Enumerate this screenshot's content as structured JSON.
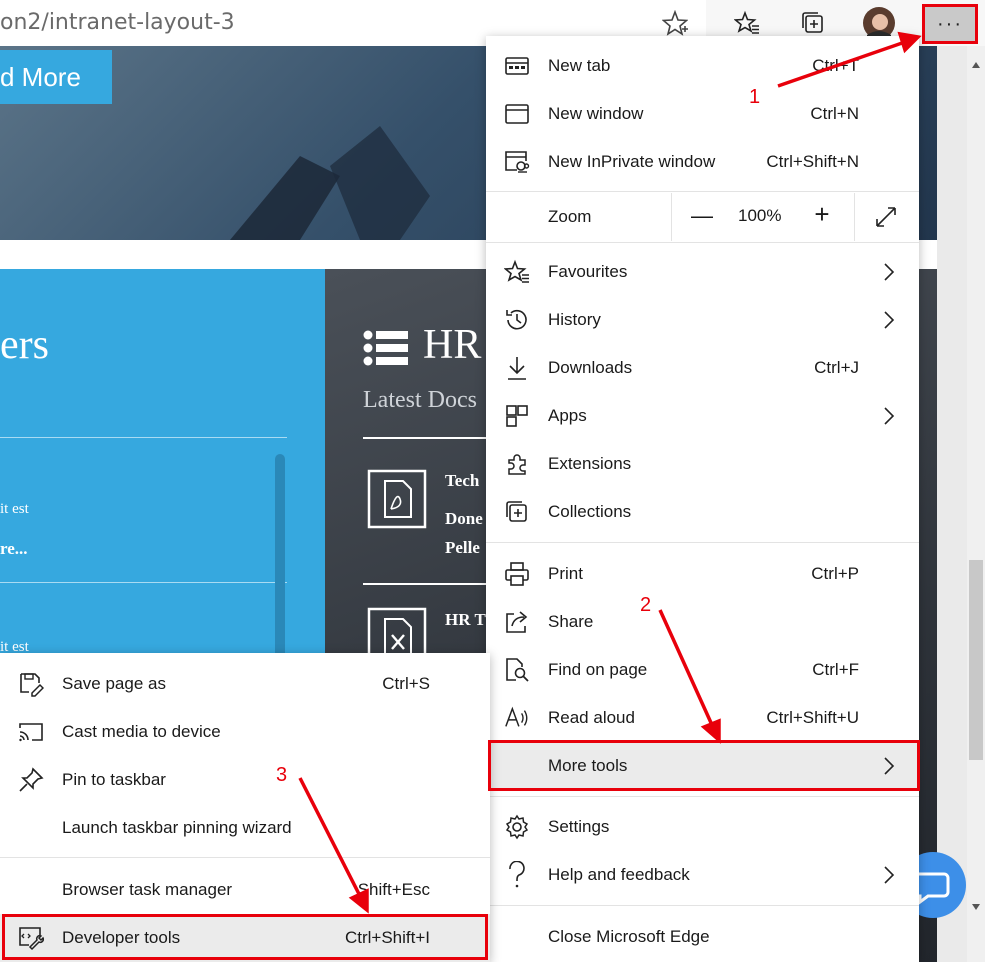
{
  "browser": {
    "url": "on2/intranet-layout-3",
    "more_button": "···"
  },
  "page": {
    "read_more": "d More",
    "left_heading": "ers",
    "left_text_1": "it est",
    "left_link_1": "re...",
    "left_text_2": "it est",
    "hr_heading": "HR",
    "latest_docs": "Latest Docs",
    "doc1_title": "Tech",
    "doc1_line1": "Done",
    "doc1_line2": "Pelle",
    "doc2_title": "HR T"
  },
  "main_menu": {
    "new_tab": {
      "label": "New tab",
      "shortcut": "Ctrl+T"
    },
    "new_window": {
      "label": "New window",
      "shortcut": "Ctrl+N"
    },
    "new_inprivate": {
      "label": "New InPrivate window",
      "shortcut": "Ctrl+Shift+N"
    },
    "zoom": {
      "label": "Zoom",
      "minus": "—",
      "value": "100%",
      "plus": "+"
    },
    "favourites": {
      "label": "Favourites"
    },
    "history": {
      "label": "History"
    },
    "downloads": {
      "label": "Downloads",
      "shortcut": "Ctrl+J"
    },
    "apps": {
      "label": "Apps"
    },
    "extensions": {
      "label": "Extensions"
    },
    "collections": {
      "label": "Collections"
    },
    "print": {
      "label": "Print",
      "shortcut": "Ctrl+P"
    },
    "share": {
      "label": "Share"
    },
    "find": {
      "label": "Find on page",
      "shortcut": "Ctrl+F"
    },
    "read_aloud": {
      "label": "Read aloud",
      "shortcut": "Ctrl+Shift+U"
    },
    "more_tools": {
      "label": "More tools"
    },
    "settings": {
      "label": "Settings"
    },
    "help": {
      "label": "Help and feedback"
    },
    "close": {
      "label": "Close Microsoft Edge"
    }
  },
  "sub_menu": {
    "save_page": {
      "label": "Save page as",
      "shortcut": "Ctrl+S"
    },
    "cast": {
      "label": "Cast media to device"
    },
    "pin": {
      "label": "Pin to taskbar"
    },
    "pin_wizard": {
      "label": "Launch taskbar pinning wizard"
    },
    "task_manager": {
      "label": "Browser task manager",
      "shortcut": "Shift+Esc"
    },
    "dev_tools": {
      "label": "Developer tools",
      "shortcut": "Ctrl+Shift+I"
    }
  },
  "annotations": {
    "step1": "1",
    "step2": "2",
    "step3": "3"
  },
  "colors": {
    "highlight": "#e8000b",
    "accent_blue": "#36a8df"
  }
}
